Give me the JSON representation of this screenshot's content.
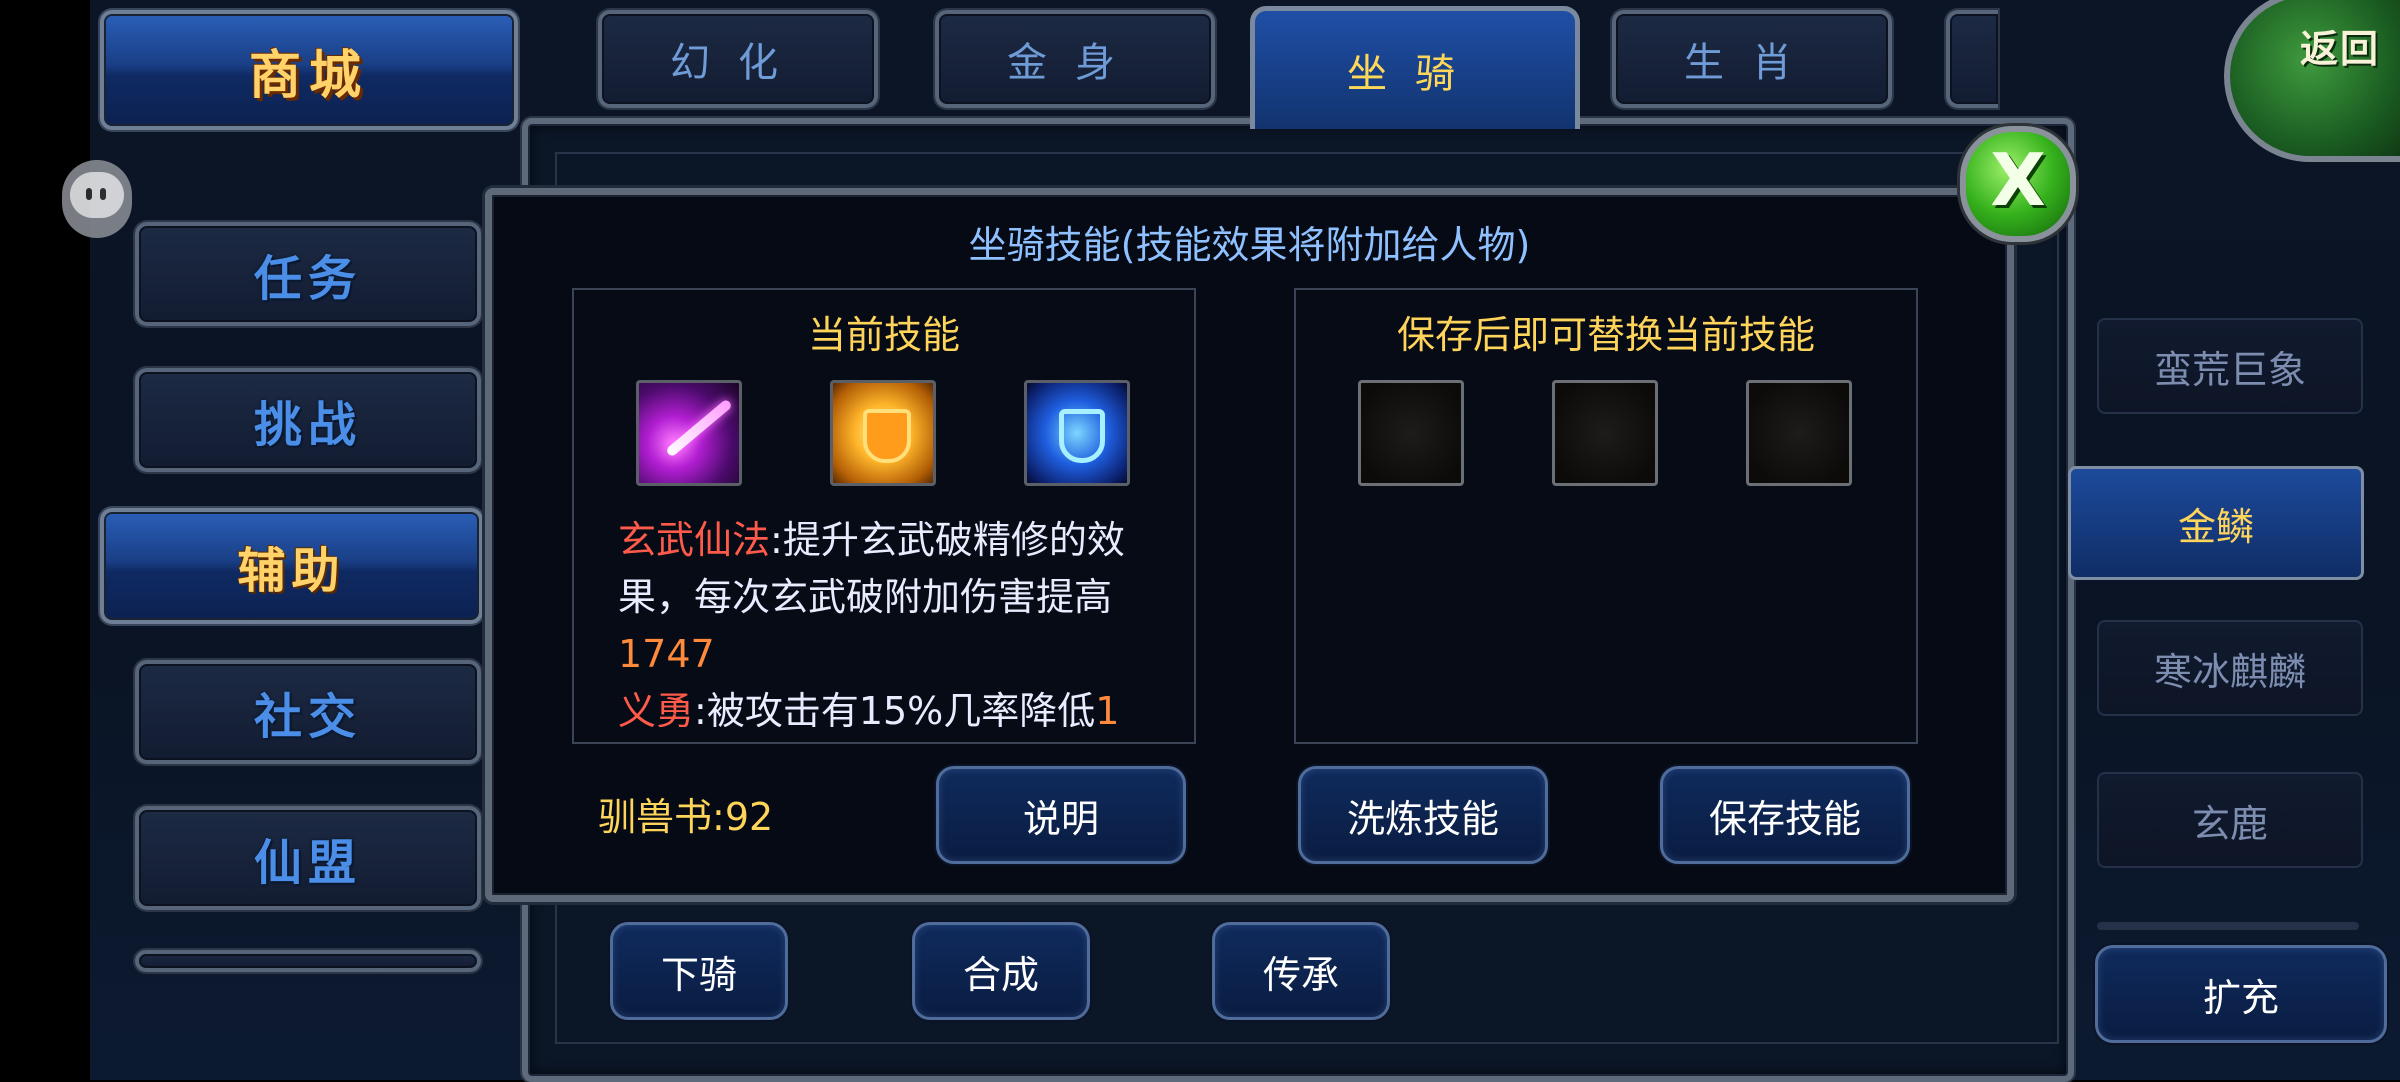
{
  "left_nav": {
    "shop": "商城",
    "items": [
      {
        "label": "任务",
        "active": false
      },
      {
        "label": "挑战",
        "active": false
      },
      {
        "label": "辅助",
        "active": true
      },
      {
        "label": "社交",
        "active": false
      },
      {
        "label": "仙盟",
        "active": false
      }
    ]
  },
  "top_tabs": [
    {
      "label": "幻化",
      "active": false
    },
    {
      "label": "金身",
      "active": false
    },
    {
      "label": "坐骑",
      "active": true
    },
    {
      "label": "生肖",
      "active": false
    }
  ],
  "back_button": "返回",
  "mount_list": [
    {
      "label": "蛮荒巨象",
      "active": false
    },
    {
      "label": "金鳞",
      "active": true
    },
    {
      "label": "寒冰麒麟",
      "active": false
    },
    {
      "label": "玄鹿",
      "active": false
    }
  ],
  "expand_button": "扩充",
  "bottom_buttons": [
    "下骑",
    "合成",
    "传承"
  ],
  "dialog": {
    "title": "坐骑技能(技能效果将附加给人物)",
    "current_header": "当前技能",
    "replace_header": "保存后即可替换当前技能",
    "skill_icons": [
      "purple-beam-skill-icon",
      "golden-shield-skill-icon",
      "blue-shield-skill-icon"
    ],
    "desc1_name": "玄武仙法",
    "desc1_text": ":提升玄武破精修的效果，每次玄武破附加伤害提高",
    "desc1_value": "1747",
    "desc2_name": "义勇",
    "desc2_text": ":被攻击有15%几率降低",
    "desc2_value": "1",
    "book_label": "驯兽书:",
    "book_count": "92",
    "buttons": {
      "explain": "说明",
      "refine": "洗炼技能",
      "save": "保存技能"
    },
    "close_label": "X"
  },
  "colors": {
    "accent_gold": "#ffd45a",
    "highlight_red": "#ff5a4a",
    "value_orange": "#ff8a3c",
    "title_blue": "#8fc0ff"
  }
}
